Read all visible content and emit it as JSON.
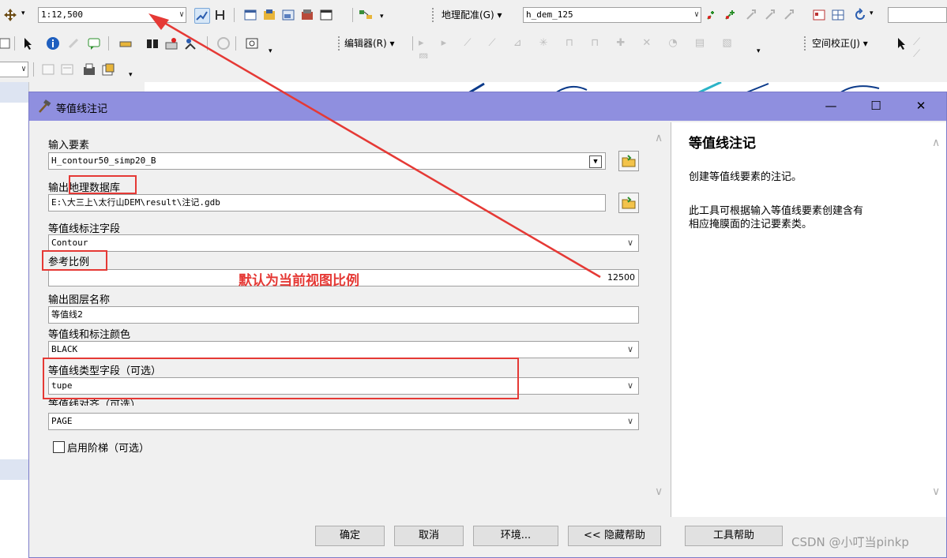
{
  "toolbar": {
    "scale_value": "1:12,500",
    "georef_menu": "地理配准(G)",
    "georef_layer": "h_dem_125",
    "editor_menu": "编辑器(R)",
    "spatial_adjust_menu": "空间校正(J)"
  },
  "dialog": {
    "title": "等值线注记",
    "fields": {
      "input_features_label": "输入要素",
      "input_features_value": "H_contour50_simp20_B",
      "output_gdb_label": "输出地理数据库",
      "output_gdb_value": "E:\\大三上\\太行山DEM\\result\\注记.gdb",
      "label_field_label": "等值线标注字段",
      "label_field_value": "Contour",
      "ref_scale_label": "参考比例",
      "ref_scale_value": "12500",
      "out_layer_label": "输出图层名称",
      "out_layer_value": "等值线2",
      "color_label": "等值线和标注颜色",
      "color_value": "BLACK",
      "type_field_label": "等值线类型字段（可选）",
      "type_field_value": "tupe",
      "alignment_label": "等值线对齐（可选）",
      "alignment_value": "PAGE",
      "ladder_label": "启用阶梯（可选）"
    },
    "annotation": "默认为当前视图比例",
    "help_panel": {
      "title": "等值线注记",
      "para1": "创建等值线要素的注记。",
      "para2_line1": "此工具可根据输入等值线要素创建含有",
      "para2_line2": "相应掩膜面的注记要素类。"
    },
    "buttons": {
      "ok": "确定",
      "cancel": "取消",
      "environments": "环境...",
      "hide_help": "<< 隐藏帮助",
      "tool_help": "工具帮助"
    }
  },
  "watermark": "CSDN @小叮当pinkp",
  "colors": {
    "title_bar": "#8f8fdf",
    "annotation_red": "#e53935"
  }
}
